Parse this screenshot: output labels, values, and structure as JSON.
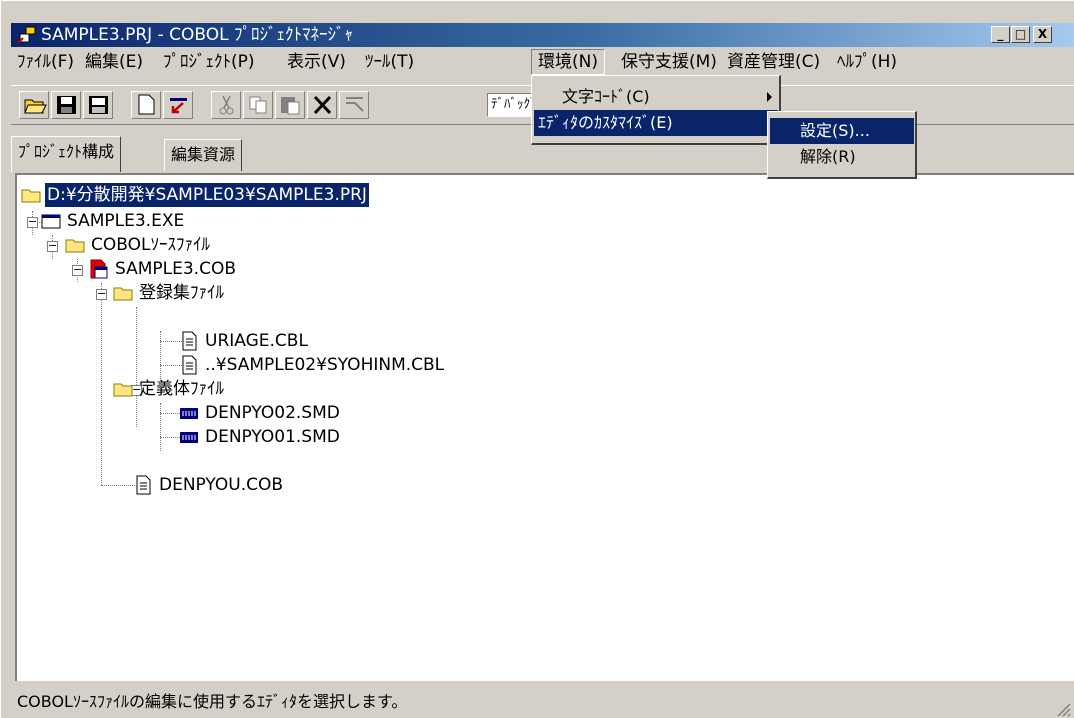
{
  "window": {
    "title": "SAMPLE3.PRJ - COBOL ﾌﾟﾛｼﾞｪｸﾄﾏﾈｰｼﾞｬ",
    "minimize": "_",
    "maximize": "□",
    "close": "X"
  },
  "menubar": [
    {
      "label": "ﾌｧｲﾙ(F)"
    },
    {
      "label": "編集(E)"
    },
    {
      "label": "ﾌﾟﾛｼﾞｪｸﾄ(P)"
    },
    {
      "label": "表示(V)"
    },
    {
      "label": "ﾂｰﾙ(T)"
    },
    {
      "label": "環境(N)"
    },
    {
      "label": "保守支援(M)"
    },
    {
      "label": "資産管理(C)"
    },
    {
      "label": "ﾍﾙﾌﾟ(H)"
    }
  ],
  "toolbar": {
    "combo_value": "ﾃﾞﾊﾞｯｸﾞ",
    "buttons": [
      "open-icon",
      "save-icon",
      "save-all-icon",
      "new-icon",
      "import-icon",
      "cut-icon",
      "copy-icon",
      "paste-icon",
      "delete-icon",
      "compile-icon"
    ]
  },
  "tabs": {
    "project": "ﾌﾟﾛｼﾞｪｸﾄ構成",
    "resources": "編集資源"
  },
  "tree": {
    "root": "D:¥分散開発¥SAMPLE03¥SAMPLE3.PRJ",
    "exe": "SAMPLE3.EXE",
    "src_folder": "COBOLｿｰｽﾌｧｲﾙ",
    "cob1": "SAMPLE3.COB",
    "lib_folder": "登録集ﾌｧｲﾙ",
    "cbl1": "URIAGE.CBL",
    "cbl2": "..¥SAMPLE02¥SYOHINM.CBL",
    "smd_folder": "定義体ﾌｧｲﾙ",
    "smd1": "DENPYO02.SMD",
    "smd2": "DENPYO01.SMD",
    "cob2": "DENPYOU.COB"
  },
  "menu_env": {
    "items": [
      "文字ｺｰﾄﾞ(C)",
      "ｴﾃﾞｨﾀのｶｽﾀﾏｲｽﾞ(E)"
    ]
  },
  "menu_custom": {
    "items": [
      "設定(S)...",
      "解除(R)"
    ]
  },
  "status": "COBOLｿｰｽﾌｧｲﾙの編集に使用するｴﾃﾞｨﾀを選択します。",
  "colors": {
    "title_bar": "#0a246a",
    "selection": "#0a246a",
    "face": "#d4d0c8"
  }
}
